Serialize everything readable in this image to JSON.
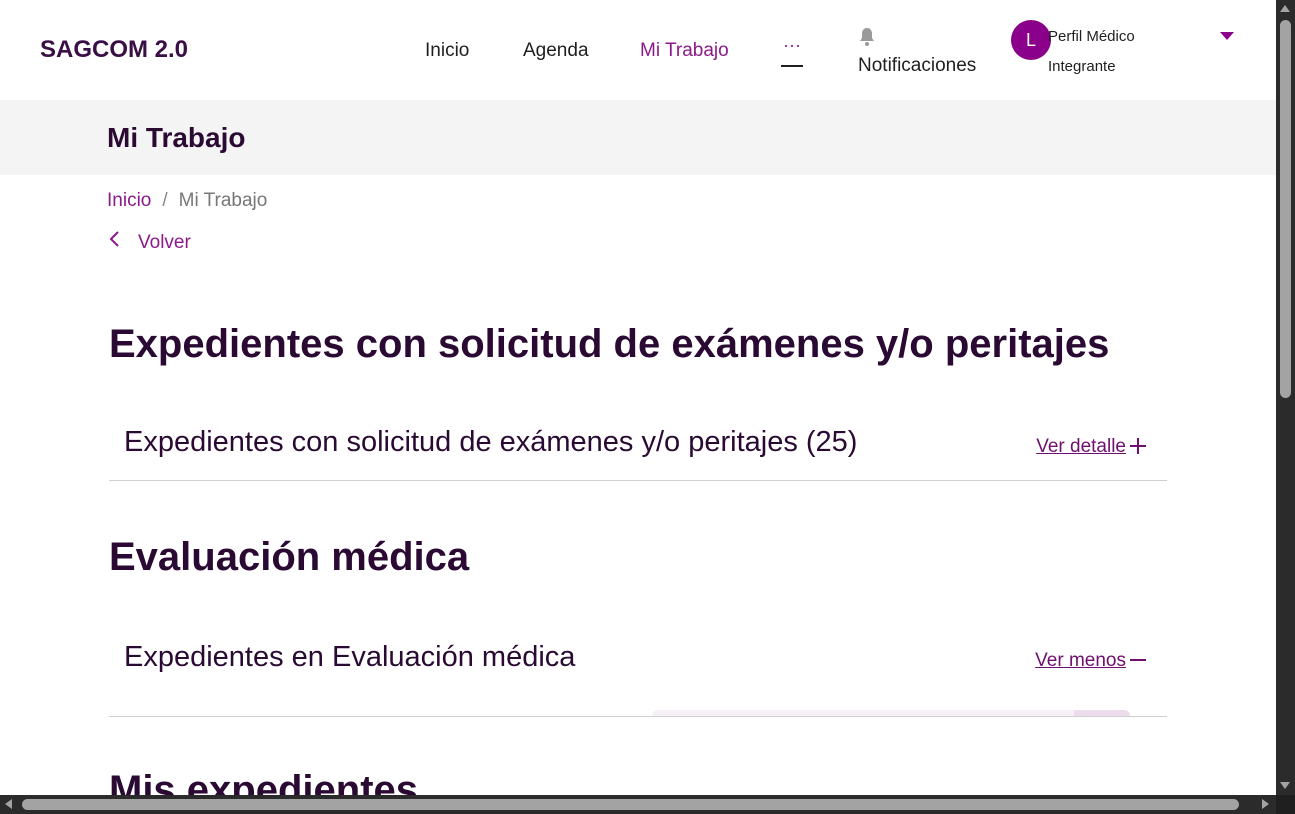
{
  "header": {
    "brand": "SAGCOM 2.0",
    "nav": {
      "inicio": "Inicio",
      "agenda": "Agenda",
      "mi_trabajo": "Mi Trabajo",
      "more": "···"
    },
    "notifications_label": "Notificaciones",
    "profile": {
      "avatar_initial": "L",
      "line1": "Perfil Médico",
      "line2": "Integrante"
    }
  },
  "page_band": {
    "title": "Mi Trabajo"
  },
  "breadcrumb": {
    "home": "Inicio",
    "separator": "/",
    "current": "Mi Trabajo"
  },
  "back_label": "Volver",
  "sections": [
    {
      "heading": "Expedientes con solicitud de exámenes y/o peritajes",
      "row_title": "Expedientes con solicitud de exámenes y/o peritajes (25)",
      "row_link": "Ver detalle"
    },
    {
      "heading": "Evaluación médica",
      "row_title": "Expedientes en Evaluación médica",
      "row_link": "Ver menos"
    },
    {
      "heading": "Mis expedientes"
    }
  ],
  "colors": {
    "accent": "#8b1a8b",
    "heading": "#2a0a33",
    "band_bg": "#f4f4f4",
    "avatar_bg": "#8b008b"
  },
  "icons": [
    "bell-icon",
    "chevron-left-icon",
    "plus-icon",
    "minus-icon",
    "caret-down-icon"
  ]
}
